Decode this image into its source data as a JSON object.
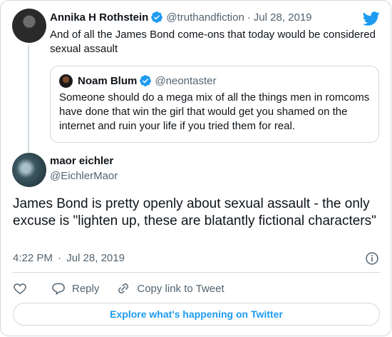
{
  "colors": {
    "accent": "#1d9bf0",
    "text": "#0f1419",
    "secondary": "#536471",
    "border": "#cfd9de"
  },
  "parent_tweet": {
    "author_name": "Annika H Rothstein",
    "handle": "@truthandfiction",
    "separator": "·",
    "date": "Jul 28, 2019",
    "text": "And of all the James Bond come-ons that today would be considered sexual assault"
  },
  "quoted_tweet": {
    "author_name": "Noam Blum",
    "handle": "@neontaster",
    "text": "Someone should do a mega mix of all the things men in romcoms have done that win the girl that would get you shamed on the internet and ruin your life if you tried them for real."
  },
  "main_tweet": {
    "author_name": "maor eichler",
    "handle": "@EichlerMaor",
    "text": "James Bond is pretty openly about sexual assault - the only excuse is \"lighten up, these are blatantly fictional characters\"",
    "time": "4:22 PM",
    "separator": "·",
    "date": "Jul 28, 2019"
  },
  "actions": {
    "like_icon": "heart-icon",
    "reply_label": "Reply",
    "copy_link_label": "Copy link to Tweet"
  },
  "explore_label": "Explore what's happening on Twitter",
  "icons": {
    "logo": "twitter-bird-icon",
    "verified": "verified-badge-icon",
    "info": "info-icon"
  }
}
